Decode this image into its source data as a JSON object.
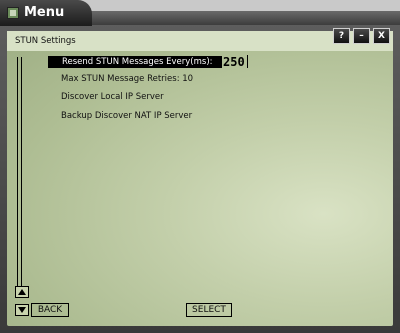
{
  "window": {
    "title": "Menu",
    "buttons": [
      {
        "label": "?",
        "icon": "help-icon"
      },
      {
        "label": "–",
        "icon": "minimize-icon"
      },
      {
        "label": "X",
        "icon": "close-icon"
      }
    ]
  },
  "section": {
    "title": "STUN Settings"
  },
  "menu": {
    "items": [
      {
        "label": "Resend STUN Messages Every(ms):",
        "value": "250",
        "selected": true
      },
      {
        "label": "Max STUN Message Retries: 10"
      },
      {
        "label": "Discover Local IP Server"
      },
      {
        "label": "Backup Discover NAT IP Server"
      }
    ]
  },
  "softkeys": {
    "back": "BACK",
    "select": "SELECT"
  },
  "icons": {
    "up": "scroll-up-arrow-icon",
    "down": "scroll-down-arrow-icon",
    "app": "app-menu-icon"
  }
}
